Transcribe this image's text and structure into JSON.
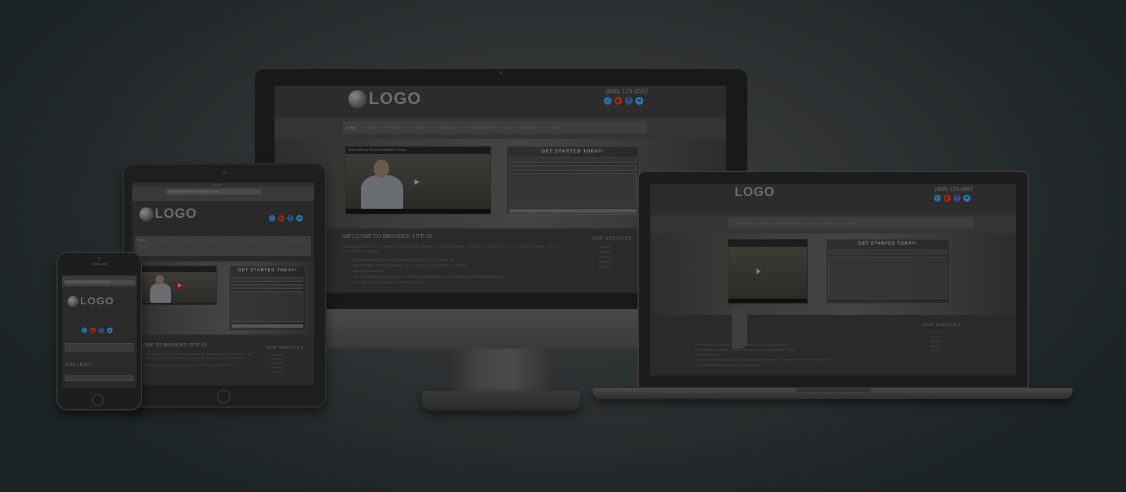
{
  "site": {
    "logo_text": "LOGO",
    "phone": "(888) 123-4567",
    "nav": [
      "HOME",
      "SERVICES",
      "PRODUCTS",
      "ABOUT US",
      "TESTIMONIALS",
      "PHOTO GALLERY",
      "BLOG",
      "CONTACT US",
      "SITEMAP"
    ],
    "video_title": "Steve Moore Branded Website Demo",
    "cta": "GET STARTED TODAY!",
    "welcome": "WELCOME TO BRANDED SITE 03",
    "tablet_welcome": "LCOME TO BRANDED SITE 03",
    "laptop_welcome": "03",
    "paragraph": "Lorem ipsum dolor sit amet, consectetur adipiscing elit. Quisque ut enim libero posuere. Nam Pyriho. Proin ac auctor nisi nec iaculis consectetur. This is a test. Test here Vestibulum.",
    "bullets": [
      "Pellentesque nunc est dolor, tristique ac eleifend sed, lobortis ipsum sed.",
      "Cras id sagittis, at sagittis, quisquam, enim nam nisl, quis eget habitasse, habitat.",
      "Tuttum ipsum dolore?",
      "Nec, acu pretius maecenas, dolor nec, blandit at gravia molestie, acu prat eleifend vulputate habitasse tortor.",
      "Nisi mollis ut egestas aliquam, et imperdi iaculis nisi."
    ],
    "services_title": "OUR SERVICES",
    "services": [
      "Service 1",
      "Service 2",
      "Service 3",
      "Service 4",
      "Service 5"
    ],
    "gallery": "GALLERY",
    "address_bar": "brandedsite03.tech.com/beta/index.html",
    "time": "9:41 AM"
  },
  "colors": {
    "twitter": "#2a6ea0",
    "youtube": "#a3241f",
    "facebook": "#2f4f86",
    "email": "#2a7db5"
  },
  "icons": {
    "social": [
      "twitter-icon",
      "youtube-icon",
      "facebook-icon",
      "email-icon"
    ],
    "play": "play-icon"
  }
}
